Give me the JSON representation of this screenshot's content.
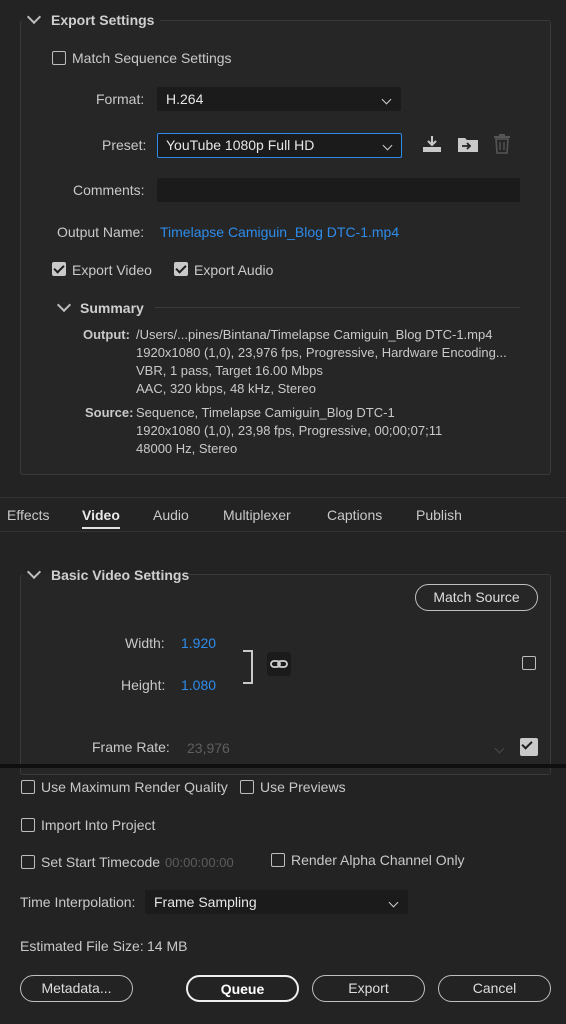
{
  "export_settings": {
    "title": "Export Settings",
    "match_sequence_label": "Match Sequence Settings",
    "match_sequence_checked": false,
    "format_label": "Format:",
    "format_value": "H.264",
    "preset_label": "Preset:",
    "preset_value": "YouTube 1080p Full HD",
    "comments_label": "Comments:",
    "comments_value": "",
    "output_name_label": "Output Name:",
    "output_name_value": "Timelapse Camiguin_Blog DTC-1.mp4",
    "export_video_label": "Export Video",
    "export_video_checked": true,
    "export_audio_label": "Export Audio",
    "export_audio_checked": true
  },
  "summary": {
    "title": "Summary",
    "output_label": "Output:",
    "output_lines": [
      "/Users/...pines/Bintana/Timelapse Camiguin_Blog DTC-1.mp4",
      "1920x1080 (1,0), 23,976 fps, Progressive, Hardware Encoding...",
      "VBR, 1 pass, Target 16.00 Mbps",
      "AAC, 320 kbps, 48 kHz, Stereo"
    ],
    "source_label": "Source:",
    "source_lines": [
      "Sequence, Timelapse Camiguin_Blog DTC-1",
      "1920x1080 (1,0), 23,98 fps, Progressive, 00;00;07;11",
      "48000 Hz, Stereo"
    ]
  },
  "tabs": [
    {
      "label": "Effects",
      "active": false
    },
    {
      "label": "Video",
      "active": true
    },
    {
      "label": "Audio",
      "active": false
    },
    {
      "label": "Multiplexer",
      "active": false
    },
    {
      "label": "Captions",
      "active": false
    },
    {
      "label": "Publish",
      "active": false
    }
  ],
  "video": {
    "title": "Basic Video Settings",
    "match_source_label": "Match Source",
    "width_label": "Width:",
    "width_value": "1.920",
    "height_label": "Height:",
    "height_value": "1.080",
    "frame_rate_label": "Frame Rate:",
    "frame_rate_value": "23,976",
    "frame_rate_checked": true,
    "width_checkbox_checked": false
  },
  "bottom": {
    "max_render_label": "Use Maximum Render Quality",
    "use_previews_label": "Use Previews",
    "import_label": "Import Into Project",
    "start_timecode_label": "Set Start Timecode",
    "start_timecode_value": "00:00:00:00",
    "render_alpha_label": "Render Alpha Channel Only",
    "time_interp_label": "Time Interpolation:",
    "time_interp_value": "Frame Sampling",
    "file_size_label": "Estimated File Size:",
    "file_size_value": "14 MB",
    "metadata_label": "Metadata...",
    "queue_label": "Queue",
    "export_label": "Export",
    "cancel_label": "Cancel"
  },
  "colors": {
    "link": "#2d8ceb",
    "background": "#232323"
  }
}
